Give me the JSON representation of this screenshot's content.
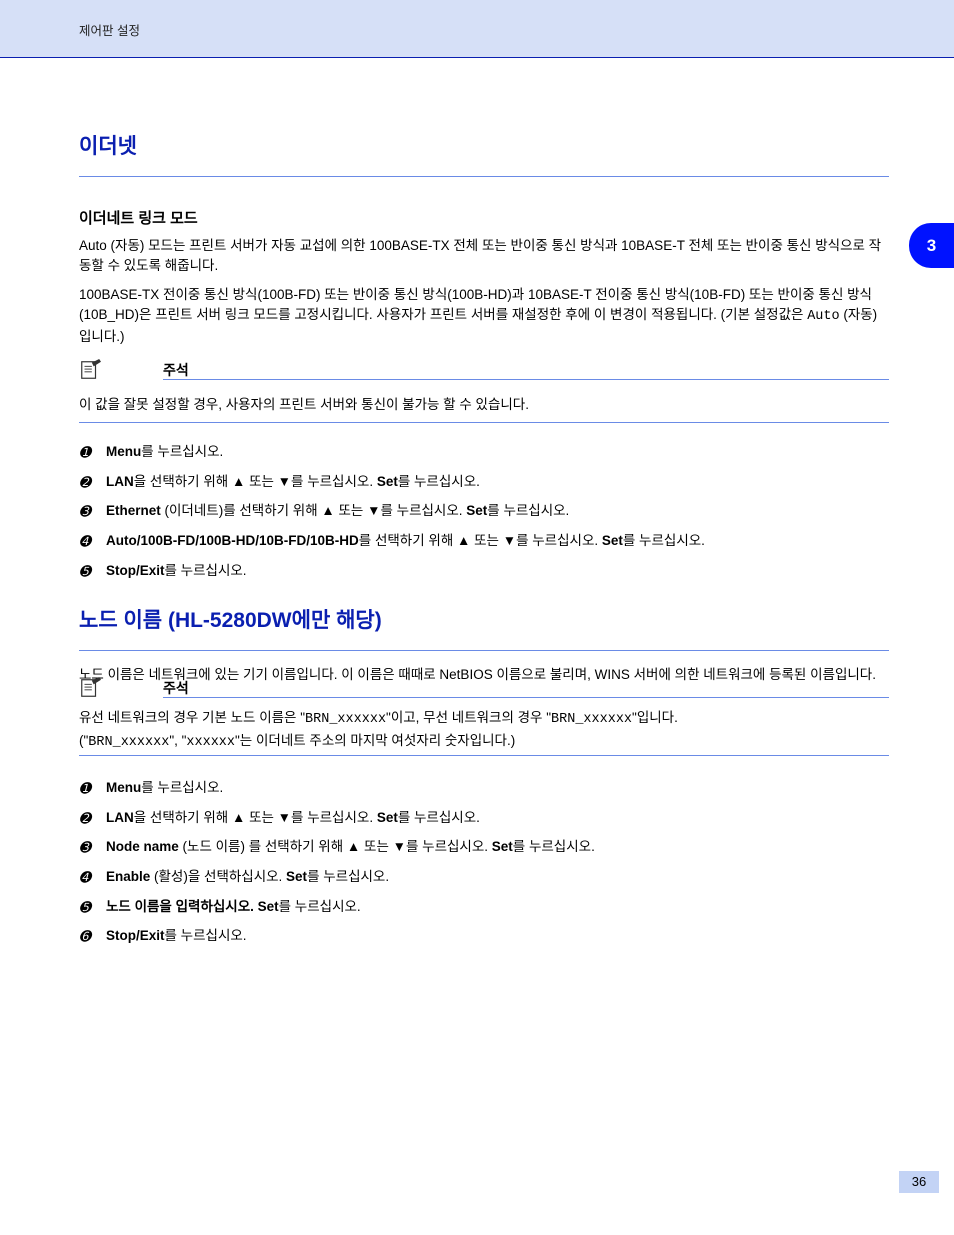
{
  "header": {
    "running_head": "제어판 설정"
  },
  "thumb_tab": {
    "label": "3"
  },
  "section_ethernet": {
    "title": "이더넷",
    "subheading": "이더네트 링크 모드",
    "para_before_auto": "Auto (자동) 모드는 프린트 서버가 자동 교섭에 의한 100BASE-TX 전체 또는 반이중 통신 방식과 10BASE-T 전체 또는 반이중 통신 방식으로 작동할 수 있도록 해줍니다.",
    "para_after_auto": "100BASE-TX 전이중 통신 방식(100B-FD) 또는 반이중 통신 방식(100B-HD)과 10BASE-T 전이중 통신 방식(10B-FD) 또는 반이중 통신 방식(10B_HD)은 프린트 서버 링크 모드를 고정시킵니다. 사용자가 프린트 서버를 재설정한 후에 이 변경이 적용됩니다. (기본 설정값은 ",
    "auto_label": "Auto",
    "after_auto_literal": " (자동)입니다.)",
    "note_label": "주석",
    "note_text": "이 값을 잘못 설정할 경우, 사용자의 프린트 서버와 통신이 불가능 할 수 있습니다.",
    "steps": [
      {
        "no": "➊",
        "text_a": "Menu",
        "text_b": "를 누르십시오."
      },
      {
        "no": "➋",
        "text_a": "LAN",
        "text_b": "을 선택하기 위해 ",
        "text_c": "▲",
        "text_d": " 또는 ",
        "text_e": "▼",
        "text_f": "를 누르십시오.",
        "text_g": " Set",
        "text_h": "를 누르십시오."
      },
      {
        "no": "➌",
        "text_a": "Ethernet",
        "text_b": " (이더네트)를 선택하기 위해 ",
        "text_c": "▲",
        "text_d": " 또는 ",
        "text_e": "▼",
        "text_f": "를 누르십시오.",
        "text_g": " Set",
        "text_h": "를 누르십시오."
      },
      {
        "no": "➍",
        "text_a": "Auto/100B-FD/100B-HD/10B-FD/10B-HD",
        "text_b": "를 선택하기 위해 ",
        "text_c": "▲",
        "text_d": " 또는 ",
        "text_e": "▼",
        "text_f": "를 누르십시오.",
        "text_g": " Set",
        "text_h": "를 누르십시오."
      },
      {
        "no": "➎",
        "text_a": "Stop/Exit",
        "text_b": "를 누르십시오."
      }
    ]
  },
  "section_nodename": {
    "title": "노드 이름 (HL-5280DW에만 해당)",
    "para": "노드 이름은 네트워크에 있는 기기 이름입니다. 이 이름은 때때로 NetBIOS 이름으로 불리며, WINS 서버에 의한 네트워크에 등록된 이름입니다.",
    "note_label": "주석",
    "note_line1_a": "유선 네트워크의 경우 기본 노드 이름은 \"",
    "note_line1_b": "BRN_xxxxxx",
    "note_line1_c": "\"이고, 무선 네트워크의 경우 \"",
    "note_line1_d": "BRN_xxxxxx",
    "note_line1_e": "\"입니다.",
    "note_line2_a": "(\"",
    "note_line2_b": "BRN_xxxxxx",
    "note_line2_c": "\", \"",
    "note_line2_d": "xxxxxx",
    "note_line2_e": "\"는 이더네트 주소의 마지막 여섯자리 숫자입니다.)",
    "steps": [
      {
        "no": "➊",
        "text_a": "Menu",
        "text_b": "를 누르십시오."
      },
      {
        "no": "➋",
        "text_a": "LAN",
        "text_b": "을 선택하기 위해 ",
        "text_c": "▲",
        "text_d": " 또는 ",
        "text_e": "▼",
        "text_f": "를 누르십시오.",
        "text_g": " Set",
        "text_h": "를 누르십시오."
      },
      {
        "no": "➌",
        "text_a": "Node name",
        "text_b": " (노드 이름) 를 선택하기 위해 ",
        "text_c": "▲",
        "text_d": " 또는 ",
        "text_e": "▼",
        "text_f": "를 누르십시오.",
        "text_g": " Set",
        "text_h": "를 누르십시오."
      },
      {
        "no": "➍",
        "text_a": "Enable",
        "text_b": " (활성)을 선택하십시오. ",
        "text_c": "Set",
        "text_d": "를 누르십시오."
      },
      {
        "no": "➎",
        "text_a": "노드 이름을 입력하십시오.",
        "text_g": " Set",
        "text_h": "를 누르십시오."
      },
      {
        "no": "➏",
        "text_a": "Stop/Exit",
        "text_b": "를 누르십시오."
      }
    ]
  },
  "footer": {
    "page_no": "36"
  }
}
